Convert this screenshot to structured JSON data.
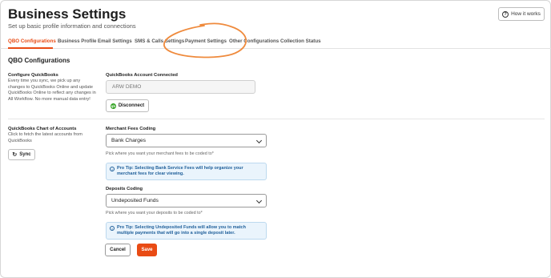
{
  "header": {
    "title": "Business Settings",
    "subtitle": "Set up basic profile information and connections",
    "how_button_label": "How it works"
  },
  "tabs": [
    {
      "label": "QBO Configurations",
      "active": true
    },
    {
      "label": "Business Profile"
    },
    {
      "label": "Email Settings"
    },
    {
      "label": "SMS & Calls Settings"
    },
    {
      "label": "Payment Settings"
    },
    {
      "label": "Other Configurations"
    },
    {
      "label": "Collection Status"
    }
  ],
  "section": {
    "title": "QBO Configurations",
    "configure": {
      "label": "Configure QuickBooks",
      "description": "Every time you sync, we pick up any changes to QuickBooks Online and update QuickBooks Online to reflect any changes in All Workflow. No more manual data entry!",
      "account_label": "QuickBooks Account Connected",
      "account_value": "ARW DEMO",
      "disconnect_label": "Disconnect",
      "qb_icon": "qb"
    },
    "chart_of_accounts": {
      "label": "QuickBooks Chart of Accounts",
      "description": "Click to fetch the latest accounts from QuickBooks",
      "sync_label": "Sync"
    },
    "merchant_fees": {
      "label": "Merchant Fees Coding",
      "selected": "Bank Charges",
      "help": "Pick where you want your merchant fees to be coded to*",
      "tip": "Pro Tip: Selecting Bank Service Fees will help organize your merchant fees for clear viewing."
    },
    "deposits": {
      "label": "Deposits Coding",
      "selected": "Undeposited Funds",
      "help": "Pick where you want your deposits to be coded to*",
      "tip": "Pro Tip: Selecting Undeposited Funds will allow you to match multiple payments that will go into a single deposit later."
    },
    "cancel_label": "Cancel",
    "save_label": "Save"
  },
  "colors": {
    "accent": "#e94b14",
    "tip_background": "#eaf4fc",
    "tip_text": "#1f5f9a",
    "quickbooks_green": "#2ca01c"
  }
}
